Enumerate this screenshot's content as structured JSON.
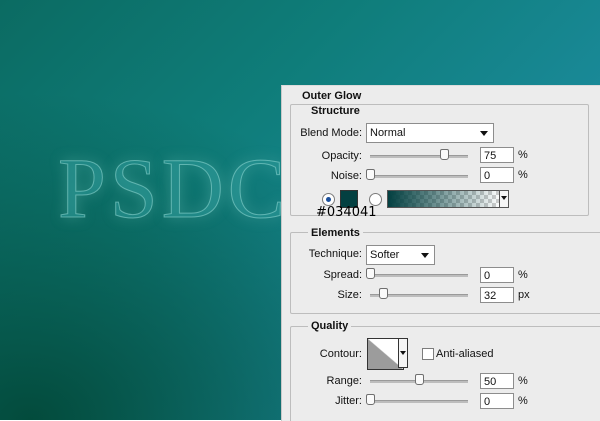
{
  "canvas": {
    "text": "PSDC",
    "bg_color": "#0f7d7a"
  },
  "dialog": {
    "title": "Outer Glow",
    "structure": {
      "title": "Structure",
      "blend_mode_label": "Blend Mode:",
      "blend_mode_value": "Normal",
      "opacity_label": "Opacity:",
      "opacity_value": "75",
      "opacity_unit": "%",
      "opacity_level": 0.75,
      "noise_label": "Noise:",
      "noise_value": "0",
      "noise_unit": "%",
      "noise_level": 0.0,
      "glow_color": "#034041",
      "glow_color_label": "#034041"
    },
    "elements": {
      "title": "Elements",
      "technique_label": "Technique:",
      "technique_value": "Softer",
      "spread_label": "Spread:",
      "spread_value": "0",
      "spread_unit": "%",
      "spread_level": 0.0,
      "size_label": "Size:",
      "size_value": "32",
      "size_unit": "px",
      "size_level": 0.13
    },
    "quality": {
      "title": "Quality",
      "contour_label": "Contour:",
      "anti_aliased_label": "Anti-aliased",
      "anti_aliased_checked": false,
      "range_label": "Range:",
      "range_value": "50",
      "range_unit": "%",
      "range_level": 0.5,
      "jitter_label": "Jitter:",
      "jitter_value": "0",
      "jitter_unit": "%",
      "jitter_level": 0.0
    }
  }
}
